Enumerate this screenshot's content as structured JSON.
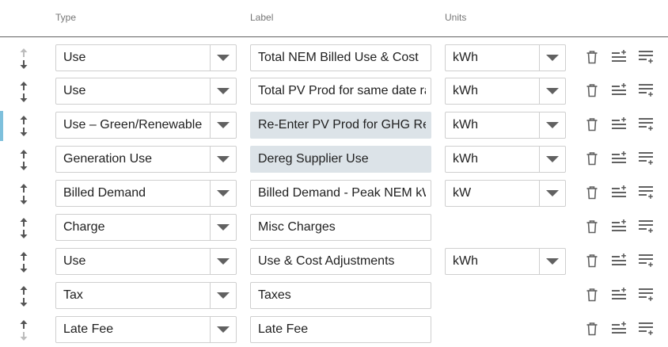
{
  "headers": {
    "type": "Type",
    "label": "Label",
    "units": "Units"
  },
  "rows": [
    {
      "type": "Use",
      "label": "Total NEM Billed Use & Cost",
      "units": "kWh",
      "has_units": true,
      "label_filled": false,
      "active": false,
      "move_up_disabled": true,
      "move_down_disabled": false
    },
    {
      "type": "Use",
      "label": "Total PV Prod for same date range",
      "units": "kWh",
      "has_units": true,
      "label_filled": false,
      "active": false,
      "move_up_disabled": false,
      "move_down_disabled": false
    },
    {
      "type": "Use – Green/Renewable",
      "label": "Re-Enter PV Prod for GHG Report",
      "units": "kWh",
      "has_units": true,
      "label_filled": true,
      "active": true,
      "move_up_disabled": false,
      "move_down_disabled": false
    },
    {
      "type": "Generation Use",
      "label": "Dereg Supplier Use",
      "units": "kWh",
      "has_units": true,
      "label_filled": true,
      "active": false,
      "move_up_disabled": false,
      "move_down_disabled": false
    },
    {
      "type": "Billed Demand",
      "label": "Billed Demand - Peak NEM kW",
      "units": "kW",
      "has_units": true,
      "label_filled": false,
      "active": false,
      "move_up_disabled": false,
      "move_down_disabled": false
    },
    {
      "type": "Charge",
      "label": "Misc Charges",
      "units": "",
      "has_units": false,
      "label_filled": false,
      "active": false,
      "move_up_disabled": false,
      "move_down_disabled": false
    },
    {
      "type": "Use",
      "label": "Use & Cost Adjustments",
      "units": "kWh",
      "has_units": true,
      "label_filled": false,
      "active": false,
      "move_up_disabled": false,
      "move_down_disabled": false
    },
    {
      "type": "Tax",
      "label": "Taxes",
      "units": "",
      "has_units": false,
      "label_filled": false,
      "active": false,
      "move_up_disabled": false,
      "move_down_disabled": false
    },
    {
      "type": "Late Fee",
      "label": "Late Fee",
      "units": "",
      "has_units": false,
      "label_filled": false,
      "active": false,
      "move_up_disabled": false,
      "move_down_disabled": true
    }
  ],
  "icons": {
    "move": "move-up-down-icon",
    "delete": "trash-icon",
    "insert_above": "insert-row-above-icon",
    "insert_below": "insert-row-below-icon",
    "dropdown": "chevron-down-icon"
  },
  "colors": {
    "active_marker": "#7ec0dc",
    "filled_input": "#dce3e8",
    "icon": "#616161",
    "icon_disabled": "#bdbdbd"
  }
}
